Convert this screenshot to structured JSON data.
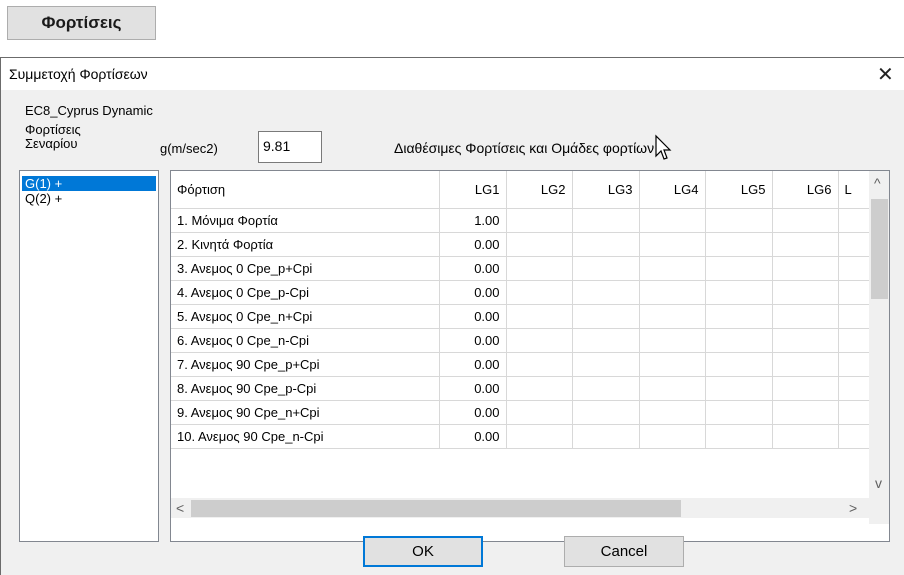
{
  "top_button": {
    "label": "Φορτίσεις"
  },
  "dialog": {
    "title": "Συμμετοχή Φορτίσεων",
    "close_glyph": "✕",
    "scenario_name": "EC8_Cyprus Dynamic",
    "scenario_loads_label_line1": "Φορτίσεις",
    "scenario_loads_label_line2": "Σεναρίου",
    "gravity_label": "g(m/sec2)",
    "gravity_value": "9.81",
    "available_loads_label": "Διαθέσιμες Φορτίσεις και Ομάδες φορτίων",
    "ok_label": "OK",
    "cancel_label": "Cancel"
  },
  "scenario_items": [
    "G(1) +",
    "Q(2) +"
  ],
  "grid": {
    "columns": [
      "Φόρτιση",
      "LG1",
      "LG2",
      "LG3",
      "LG4",
      "LG5",
      "LG6",
      "L"
    ],
    "rows": [
      {
        "name": "1. Μόνιμα Φορτία",
        "lg1": "1.00"
      },
      {
        "name": "2. Κινητά Φορτία",
        "lg1": "0.00"
      },
      {
        "name": "3. Ανεμος 0 Cpe_p+Cpi",
        "lg1": "0.00"
      },
      {
        "name": "4. Ανεμος 0 Cpe_p-Cpi",
        "lg1": "0.00"
      },
      {
        "name": "5. Ανεμος 0 Cpe_n+Cpi",
        "lg1": "0.00"
      },
      {
        "name": "6. Ανεμος 0 Cpe_n-Cpi",
        "lg1": "0.00"
      },
      {
        "name": "7. Ανεμος 90 Cpe_p+Cpi",
        "lg1": "0.00"
      },
      {
        "name": "8. Ανεμος 90 Cpe_p-Cpi",
        "lg1": "0.00"
      },
      {
        "name": "9. Ανεμος 90 Cpe_n+Cpi",
        "lg1": "0.00"
      },
      {
        "name": "10. Ανεμος 90 Cpe_n-Cpi",
        "lg1": "0.00"
      }
    ]
  },
  "scrollbars": {
    "up": "^",
    "down": "v",
    "left": "<",
    "right": ">"
  },
  "colors": {
    "selection": "#0078d7",
    "dialog_bg": "#f0f0f0"
  }
}
